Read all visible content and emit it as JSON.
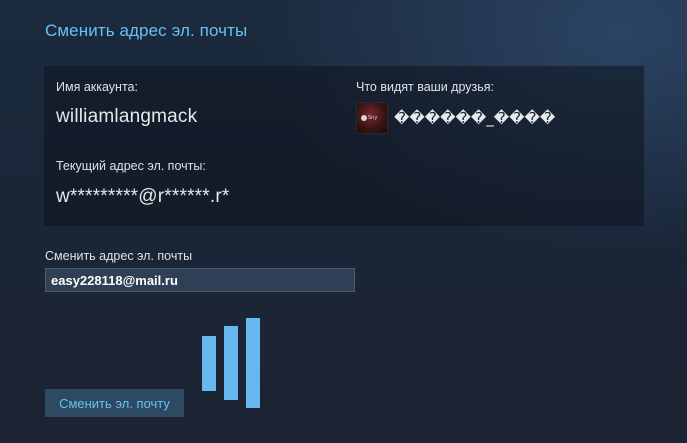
{
  "page": {
    "title": "Сменить адрес эл. почты"
  },
  "account": {
    "name_label": "Имя аккаунта:",
    "name_value": "williamlangmack",
    "friends_label": "Что видят ваши друзья:",
    "friends_display_name": "������_����",
    "email_label": "Текущий адрес эл. почты:",
    "email_value": "w*********@r******.r*"
  },
  "form": {
    "change_label": "Сменить адрес эл. почты",
    "email_input_value": "easy228118@mail.ru",
    "submit_label": "Сменить эл. почту"
  },
  "loader": {
    "icon": "loading-bars-icon",
    "color": "#66b8ee"
  },
  "colors": {
    "accent": "#67c1f5",
    "button_bg": "#2d4a62",
    "input_bg": "#2f3f55"
  }
}
